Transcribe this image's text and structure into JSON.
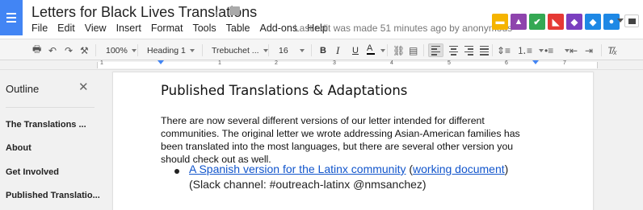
{
  "header": {
    "doc_title": "Letters for Black Lives Translations",
    "last_edit": "Last edit was made 51 minutes ago by anonymous"
  },
  "menu": [
    "File",
    "Edit",
    "View",
    "Insert",
    "Format",
    "Tools",
    "Table",
    "Add-ons",
    "Help"
  ],
  "addons": [
    {
      "icon": "elephant-icon",
      "color": "#f5b400",
      "glyph": "■"
    },
    {
      "icon": "elephant-icon",
      "color": "#8e44ad",
      "glyph": "■"
    },
    {
      "icon": "bird-icon",
      "color": "#34a853",
      "glyph": "✔"
    },
    {
      "icon": "fox-icon",
      "color": "#e53935",
      "glyph": "▲"
    },
    {
      "icon": "bird-icon",
      "color": "#7b3fbf",
      "glyph": "◆"
    },
    {
      "icon": "bird-icon",
      "color": "#1e88e5",
      "glyph": "◆"
    },
    {
      "icon": "owl-icon",
      "color": "#1e88e5",
      "glyph": "●"
    }
  ],
  "toolbar": {
    "zoom": "100%",
    "style": "Heading 1",
    "font": "Trebuchet ...",
    "size": "16",
    "bold": "B",
    "italic": "I",
    "underline": "U",
    "text_color": "A"
  },
  "ruler": [
    "1",
    "1",
    "2",
    "3",
    "4",
    "5",
    "6",
    "7"
  ],
  "outline": {
    "title": "Outline",
    "items": [
      "The Translations ...",
      "About",
      "Get Involved",
      "Published Translatio..."
    ]
  },
  "document": {
    "heading": "Published Translations & Adaptations",
    "paragraph": "There are now several different versions of our letter intended for different communities. The original letter we wrote addressing Asian-American families has been translated into the most languages, but there are several other version you should check out as well.",
    "bullet_link": "A Spanish version for the Latinx community",
    "bullet_open": " (",
    "bullet_link2": "working document",
    "bullet_close": ")",
    "bullet_rest": "(Slack channel: #outreach-latinx @nmsanchez)"
  }
}
